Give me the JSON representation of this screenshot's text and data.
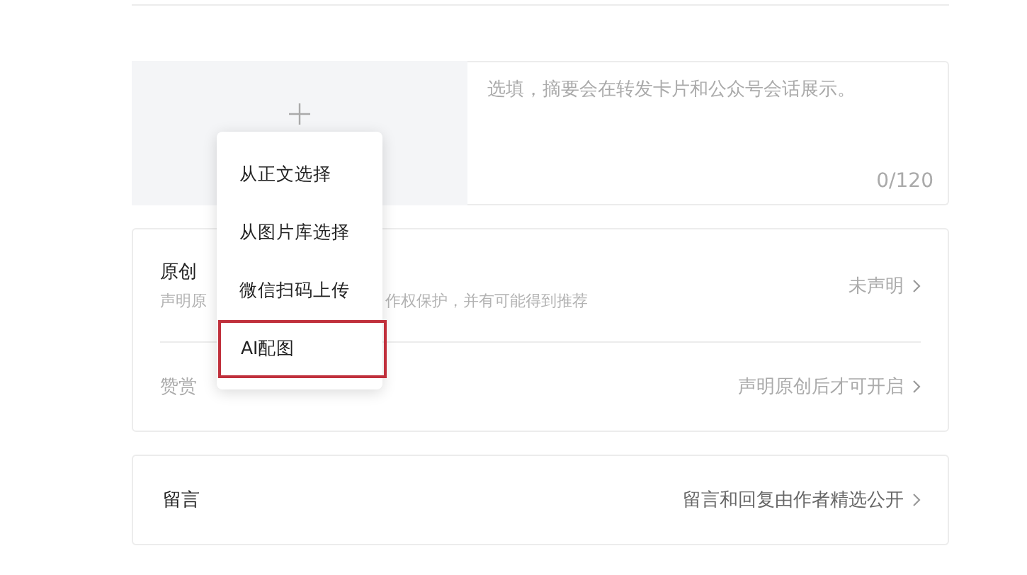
{
  "summary": {
    "placeholder": "选填，摘要会在转发卡片和公众号会话展示。",
    "counter": "0/120"
  },
  "menu": {
    "items": [
      {
        "label": "从正文选择",
        "highlighted": false
      },
      {
        "label": "从图片库选择",
        "highlighted": false
      },
      {
        "label": "微信扫码上传",
        "highlighted": false
      },
      {
        "label": "AI配图",
        "highlighted": true
      }
    ]
  },
  "settings": [
    {
      "title": "原创",
      "description_parts": [
        "声明原",
        "作权保护，并有可能得到推荐"
      ],
      "value": "未声明",
      "disabled": false
    },
    {
      "title": "赞赏",
      "value": "声明原创后才可开启",
      "disabled": true
    }
  ],
  "comments": {
    "title": "留言",
    "value": "留言和回复由作者精选公开"
  }
}
